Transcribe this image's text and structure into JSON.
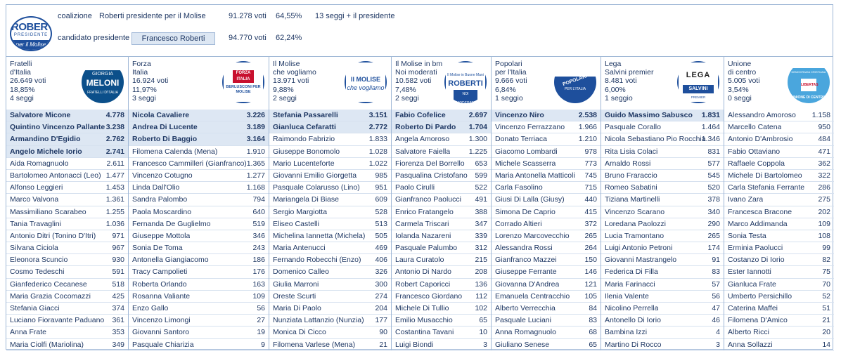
{
  "header": {
    "coalition_label": "coalizione",
    "coalition_name": "Roberti presidente per il Molise",
    "coalition_votes": "91.278 voti",
    "coalition_pct": "64,55%",
    "coalition_seats": "13 seggi + il presidente",
    "candidate_label": "candidato presidente",
    "candidate_name": "Francesco Roberti",
    "candidate_votes": "94.770 voti",
    "candidate_pct": "62,24%",
    "logo": {
      "name": "ROBERTI",
      "sub": "PRESIDENTE",
      "motto": "per il Molise"
    }
  },
  "colors": {
    "text": "#1f3864",
    "border": "#9fb7d6",
    "elected_bg": "#dde7f3"
  },
  "parties": [
    {
      "name1": "Fratelli",
      "name2": "d'Italia",
      "votes": "26.649 voti",
      "pct": "18,85%",
      "seats": "4 seggi",
      "logo": {
        "l1": "GIORGIA",
        "l2": "MELONI",
        "l3": "FRATELLI D'ITALIA"
      },
      "candidates": [
        {
          "n": "Salvatore Micone",
          "v": "4.778",
          "e": true
        },
        {
          "n": "Quintino Vincenzo Pallante",
          "v": "3.238",
          "e": true
        },
        {
          "n": "Armandino D'Egidio",
          "v": "2.762",
          "e": true
        },
        {
          "n": "Angelo Michele Iorio",
          "v": "2.741",
          "e": true
        },
        {
          "n": "Aida Romagnuolo",
          "v": "2.611"
        },
        {
          "n": "Bartolomeo Antonacci (Leo)",
          "v": "1.477"
        },
        {
          "n": "Alfonso Leggieri",
          "v": "1.453"
        },
        {
          "n": "Marco Valvona",
          "v": "1.361"
        },
        {
          "n": "Massimiliano Scarabeo",
          "v": "1.255"
        },
        {
          "n": "Tania Travaglini",
          "v": "1.036"
        },
        {
          "n": "Antonio Ditri (Tonino D'Itri)",
          "v": "971"
        },
        {
          "n": "Silvana Ciciola",
          "v": "967"
        },
        {
          "n": "Eleonora Scuncio",
          "v": "930"
        },
        {
          "n": "Cosmo Tedeschi",
          "v": "591"
        },
        {
          "n": "Gianfederico Cecanese",
          "v": "518"
        },
        {
          "n": "Maria Grazia Cocomazzi",
          "v": "425"
        },
        {
          "n": "Stefania Giacci",
          "v": "374"
        },
        {
          "n": "Luciano Fioravante Paduano",
          "v": "361"
        },
        {
          "n": "Anna Frate",
          "v": "353"
        },
        {
          "n": "Maria Ciolfi (Mariolina)",
          "v": "349"
        }
      ]
    },
    {
      "name1": "Forza",
      "name2": "Italia",
      "votes": "16.924 voti",
      "pct": "11,97%",
      "seats": "3 seggi",
      "logo": {
        "l1": "FORZA",
        "l2": "ITALIA",
        "l3": "BERLUSCONI PER MOLISE"
      },
      "candidates": [
        {
          "n": "Nicola Cavaliere",
          "v": "3.226",
          "e": true
        },
        {
          "n": "Andrea Di Lucente",
          "v": "3.189",
          "e": true
        },
        {
          "n": "Roberto Di Baggio",
          "v": "3.164",
          "e": true
        },
        {
          "n": "Filomena Calenda (Mena)",
          "v": "1.910"
        },
        {
          "n": "Francesco Cammilleri (Gianfranco)",
          "v": "1.365"
        },
        {
          "n": "Vincenzo Cotugno",
          "v": "1.277"
        },
        {
          "n": "Linda Dall'Olio",
          "v": "1.168"
        },
        {
          "n": "Sandra Palombo",
          "v": "794"
        },
        {
          "n": "Paola Moscardino",
          "v": "640"
        },
        {
          "n": "Fernanda De Guglielmo",
          "v": "519"
        },
        {
          "n": "Giuseppe Mottola",
          "v": "346"
        },
        {
          "n": "Sonia De Toma",
          "v": "243"
        },
        {
          "n": "Antonella Giangiacomo",
          "v": "186"
        },
        {
          "n": "Tracy Campolieti",
          "v": "176"
        },
        {
          "n": "Roberta Orlando",
          "v": "163"
        },
        {
          "n": "Rosanna Valiante",
          "v": "109"
        },
        {
          "n": "Enzo Gallo",
          "v": "56"
        },
        {
          "n": "Vincenzo Limongi",
          "v": "27"
        },
        {
          "n": "Giovanni Santoro",
          "v": "19"
        },
        {
          "n": "Pasquale Chiarizia",
          "v": "9"
        }
      ]
    },
    {
      "name1": "Il Molise",
      "name2": "che vogliamo",
      "votes": "13.971 voti",
      "pct": "9,88%",
      "seats": "2 seggi",
      "logo": {
        "l1": "Il MOLISE",
        "l2": "che vogliamo",
        "l3": ""
      },
      "candidates": [
        {
          "n": "Stefania Passarelli",
          "v": "3.151",
          "e": true
        },
        {
          "n": "Gianluca Cefaratti",
          "v": "2.772",
          "e": true
        },
        {
          "n": "Raimondo Fabrizio",
          "v": "1.833"
        },
        {
          "n": "Giuseppe Bonomolo",
          "v": "1.028"
        },
        {
          "n": "Mario Lucenteforte",
          "v": "1.022"
        },
        {
          "n": "Giovanni Emilio Giorgetta",
          "v": "985"
        },
        {
          "n": "Pasquale Colarusso (Lino)",
          "v": "951"
        },
        {
          "n": "Mariangela Di Biase",
          "v": "609"
        },
        {
          "n": "Sergio Margiotta",
          "v": "528"
        },
        {
          "n": "Eliseo Castelli",
          "v": "513"
        },
        {
          "n": "Michelina Iannetta (Michela)",
          "v": "505"
        },
        {
          "n": "Maria Antenucci",
          "v": "469"
        },
        {
          "n": "Fernando Robecchi (Enzo)",
          "v": "406"
        },
        {
          "n": "Domenico Calleo",
          "v": "326"
        },
        {
          "n": "Giulia Marroni",
          "v": "300"
        },
        {
          "n": "Oreste Scurti",
          "v": "274"
        },
        {
          "n": "Maria Di Paolo",
          "v": "204"
        },
        {
          "n": "Nunziata Lattanzio (Nunzia)",
          "v": "177"
        },
        {
          "n": "Monica Di Cicco",
          "v": "90"
        },
        {
          "n": "Filomena Varlese (Mena)",
          "v": "21"
        }
      ]
    },
    {
      "name1": "Il Molise in bm",
      "name2": "Noi moderati",
      "votes": "10.582 voti",
      "pct": "7,48%",
      "seats": "2 seggi",
      "logo": {
        "l1": "Il Molise in Buone Mani",
        "l2": "ROBERTI",
        "l3": "NOI MODERATI"
      },
      "candidates": [
        {
          "n": "Fabio Cofelice",
          "v": "2.697",
          "e": true
        },
        {
          "n": "Roberto Di Pardo",
          "v": "1.704",
          "e": true
        },
        {
          "n": "Angela Amoroso",
          "v": "1.300"
        },
        {
          "n": "Salvatore Faiella",
          "v": "1.225"
        },
        {
          "n": "Fiorenza Del Borrello",
          "v": "653"
        },
        {
          "n": "Pasqualina Cristofano",
          "v": "599"
        },
        {
          "n": "Paolo Cirulli",
          "v": "522"
        },
        {
          "n": "Gianfranco Paolucci",
          "v": "491"
        },
        {
          "n": "Enrico Fratangelo",
          "v": "388"
        },
        {
          "n": "Carmela Triscari",
          "v": "347"
        },
        {
          "n": "Iolanda Nazareni",
          "v": "339"
        },
        {
          "n": "Pasquale Palumbo",
          "v": "312"
        },
        {
          "n": "Laura Curatolo",
          "v": "215"
        },
        {
          "n": "Antonio Di Nardo",
          "v": "208"
        },
        {
          "n": "Robert Caporicci",
          "v": "136"
        },
        {
          "n": "Francesco Giordano",
          "v": "112"
        },
        {
          "n": "Michele Di Tullio",
          "v": "102"
        },
        {
          "n": "Emilio Musacchio",
          "v": "65"
        },
        {
          "n": "Costantina Tavani",
          "v": "10"
        },
        {
          "n": "Luigi Biondi",
          "v": "3"
        }
      ]
    },
    {
      "name1": "Popolari",
      "name2": "per l'Italia",
      "votes": "9.666 voti",
      "pct": "6,84%",
      "seats": "1 seggio",
      "logo": {
        "l1": "POPOLARI",
        "l2": "PER L'ITALIA",
        "l3": ""
      },
      "candidates": [
        {
          "n": "Vincenzo Niro",
          "v": "2.538",
          "e": true
        },
        {
          "n": "Vincenzo Ferrazzano",
          "v": "1.966"
        },
        {
          "n": "Donato Terriaca",
          "v": "1.210"
        },
        {
          "n": "Giacomo Lombardi",
          "v": "978"
        },
        {
          "n": "Michele Scasserra",
          "v": "773"
        },
        {
          "n": "Maria Antonella Matticoli",
          "v": "745"
        },
        {
          "n": "Carla Fasolino",
          "v": "715"
        },
        {
          "n": "Giusi Di Lalla (Giusy)",
          "v": "440"
        },
        {
          "n": "Simona De Caprio",
          "v": "415"
        },
        {
          "n": "Corrado Altieri",
          "v": "372"
        },
        {
          "n": "Lorenzo Marcovecchio",
          "v": "265"
        },
        {
          "n": "Alessandra Rossi",
          "v": "264"
        },
        {
          "n": "Gianfranco Mazzei",
          "v": "150"
        },
        {
          "n": "Giuseppe Ferrante",
          "v": "146"
        },
        {
          "n": "Giovanna D'Andrea",
          "v": "121"
        },
        {
          "n": "Emanuela Centracchio",
          "v": "105"
        },
        {
          "n": "Alberto Verrecchia",
          "v": "84"
        },
        {
          "n": "Pasquale Luciani",
          "v": "83"
        },
        {
          "n": "Anna Romagnuolo",
          "v": "68"
        },
        {
          "n": "Giuliano Senese",
          "v": "65"
        }
      ]
    },
    {
      "name1": "Lega",
      "name2": "Salvini premier",
      "votes": "8.481 voti",
      "pct": "6,00%",
      "seats": "1 seggio",
      "logo": {
        "l1": "LEGA",
        "l2": "SALVINI",
        "l3": "PREMIER"
      },
      "candidates": [
        {
          "n": "Guido Massimo Sabusco",
          "v": "1.831",
          "e": true
        },
        {
          "n": "Pasquale Corallo",
          "v": "1.464"
        },
        {
          "n": "Nicola Sebastiano Pio Rocchia",
          "v": "1.346"
        },
        {
          "n": "Rita Lisia Colaci",
          "v": "831"
        },
        {
          "n": "Arnaldo Rossi",
          "v": "577"
        },
        {
          "n": "Bruno Fraraccio",
          "v": "545"
        },
        {
          "n": "Romeo Sabatini",
          "v": "520"
        },
        {
          "n": "Tiziana Martinelli",
          "v": "378"
        },
        {
          "n": "Vincenzo Scarano",
          "v": "340"
        },
        {
          "n": "Loredana Paolozzi",
          "v": "290"
        },
        {
          "n": "Lucia Tramontano",
          "v": "265"
        },
        {
          "n": "Luigi Antonio Petroni",
          "v": "174"
        },
        {
          "n": "Giovanni Mastrangelo",
          "v": "91"
        },
        {
          "n": "Federica Di Filla",
          "v": "83"
        },
        {
          "n": "Maria Farinacci",
          "v": "57"
        },
        {
          "n": "Ilenia Valente",
          "v": "56"
        },
        {
          "n": "Nicolino Perrella",
          "v": "47"
        },
        {
          "n": "Antonello Di Iorio",
          "v": "46"
        },
        {
          "n": "Bambina Izzi",
          "v": "4"
        },
        {
          "n": "Martino Di Rocco",
          "v": "3"
        }
      ]
    },
    {
      "name1": "Unione",
      "name2": "di centro",
      "votes": "5.005 voti",
      "pct": "3,54%",
      "seats": "0 seggi",
      "logo": {
        "l1": "DEMOCRAZIA CRISTIANA",
        "l2": "LIBERTAS",
        "l3": "UNIONE DI CENTRO"
      },
      "candidates": [
        {
          "n": "Alessandro Amoroso",
          "v": "1.158"
        },
        {
          "n": "Marcello Catena",
          "v": "950"
        },
        {
          "n": "Antonio D'Ambrosio",
          "v": "484"
        },
        {
          "n": "Fabio Ottaviano",
          "v": "471"
        },
        {
          "n": "Raffaele Coppola",
          "v": "362"
        },
        {
          "n": "Michele Di Bartolomeo",
          "v": "322"
        },
        {
          "n": "Carla Stefania Ferrante",
          "v": "286"
        },
        {
          "n": "Ivano Zara",
          "v": "275"
        },
        {
          "n": "Francesca Bracone",
          "v": "202"
        },
        {
          "n": "Marco Addimanda",
          "v": "109"
        },
        {
          "n": "Sonia Testa",
          "v": "108"
        },
        {
          "n": "Erminia Paolucci",
          "v": "99"
        },
        {
          "n": "Costanzo Di Iorio",
          "v": "82"
        },
        {
          "n": "Ester Iannotti",
          "v": "75"
        },
        {
          "n": "Gianluca Frate",
          "v": "70"
        },
        {
          "n": "Umberto Persichillo",
          "v": "52"
        },
        {
          "n": "Caterina Maffei",
          "v": "51"
        },
        {
          "n": "Filomena D'Amico",
          "v": "21"
        },
        {
          "n": "Alberto Ricci",
          "v": "20"
        },
        {
          "n": "Anna Sollazzi",
          "v": "14"
        }
      ]
    }
  ]
}
